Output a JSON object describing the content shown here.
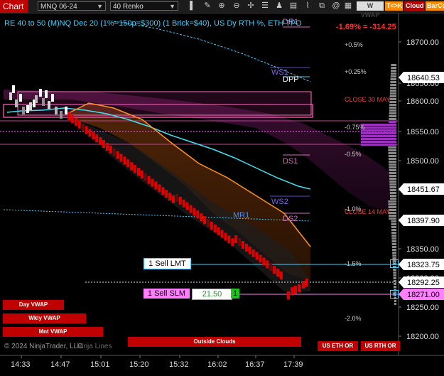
{
  "toolbar": {
    "tab_label": "Chart",
    "instrument": "MNQ 06-24",
    "bar_type": "40 Renko",
    "btn_vwap": "W VWAP",
    "btn_tok": "T<>K",
    "btn_cloud": "Cloud",
    "btn_barco": "BarCo",
    "icons": [
      "bar-style-icon",
      "pencil-icon",
      "zoom-in-icon",
      "zoom-out-icon",
      "crosshair-icon",
      "properties-icon",
      "strategy-icon",
      "data-box-icon",
      "indicators-icon",
      "templates-icon",
      "at-icon",
      "tile-icon",
      "pane-icon"
    ]
  },
  "header": {
    "title": "RE 40 to 50 (M)NQ Dec 20 (1%=150p=$300) (1 Brick=$40), US Dy RTH %, ETH TPO",
    "pnl": "-1.69% = -314.25"
  },
  "price_axis": {
    "ticks": [
      "18700.00",
      "18650.00",
      "18600.00",
      "18550.00",
      "18500.00",
      "18450.00",
      "18400.00",
      "18350.00",
      "18300.00",
      "18250.00",
      "18200.00"
    ],
    "markers": [
      {
        "label": "18640.53",
        "bg": "#ffffff",
        "fg": "#000000"
      },
      {
        "label": "18451.67",
        "bg": "#ffffff",
        "fg": "#000000"
      },
      {
        "label": "18397.90",
        "bg": "#ffffff",
        "fg": "#000000"
      },
      {
        "label": "18323.75",
        "bg": "#ffffff",
        "fg": "#000000"
      },
      {
        "label": "18292.25",
        "bg": "#ffffff",
        "fg": "#000000"
      },
      {
        "label": "18271.00",
        "bg": "#ff80ff",
        "fg": "#000000"
      }
    ]
  },
  "time_axis": [
    "14:33",
    "14:47",
    "15:01",
    "15:20",
    "15:32",
    "16:02",
    "16:37",
    "17:39"
  ],
  "levels": {
    "dr1": "DR1",
    "ws1": "WS1",
    "dpp": "DPP",
    "ds1": "DS1",
    "ws2": "WS2",
    "mr1": "MR1",
    "ds2": "DS2",
    "close30": "CLOSE 30 MAY",
    "close14": "CLOSE 14 MAY",
    "p05": "+0.5%",
    "p025": "+0.25%",
    "p075": "-0.75%",
    "m05": "-0.5%",
    "m10": "-1.0%",
    "m15": "-1.5%",
    "m20": "-2.0%"
  },
  "orders": {
    "sell_lmt": "1 Sell LMT",
    "sell_slm": "1 Sell SLM",
    "sl_price": "21.50",
    "qty": "1"
  },
  "buttons": {
    "day_vwap": "Day VWAP",
    "wkly_vwap": "Wkly VWAP",
    "mnt_vwap": "Mnt VWAP",
    "outside_clouds": "Outside Clouds",
    "us_eth_or": "US ETH OR",
    "us_rth_or": "US RTH OR"
  },
  "copyright": "© 2024 NinjaTrader, LLC",
  "watermark": "Ninja Lines"
}
